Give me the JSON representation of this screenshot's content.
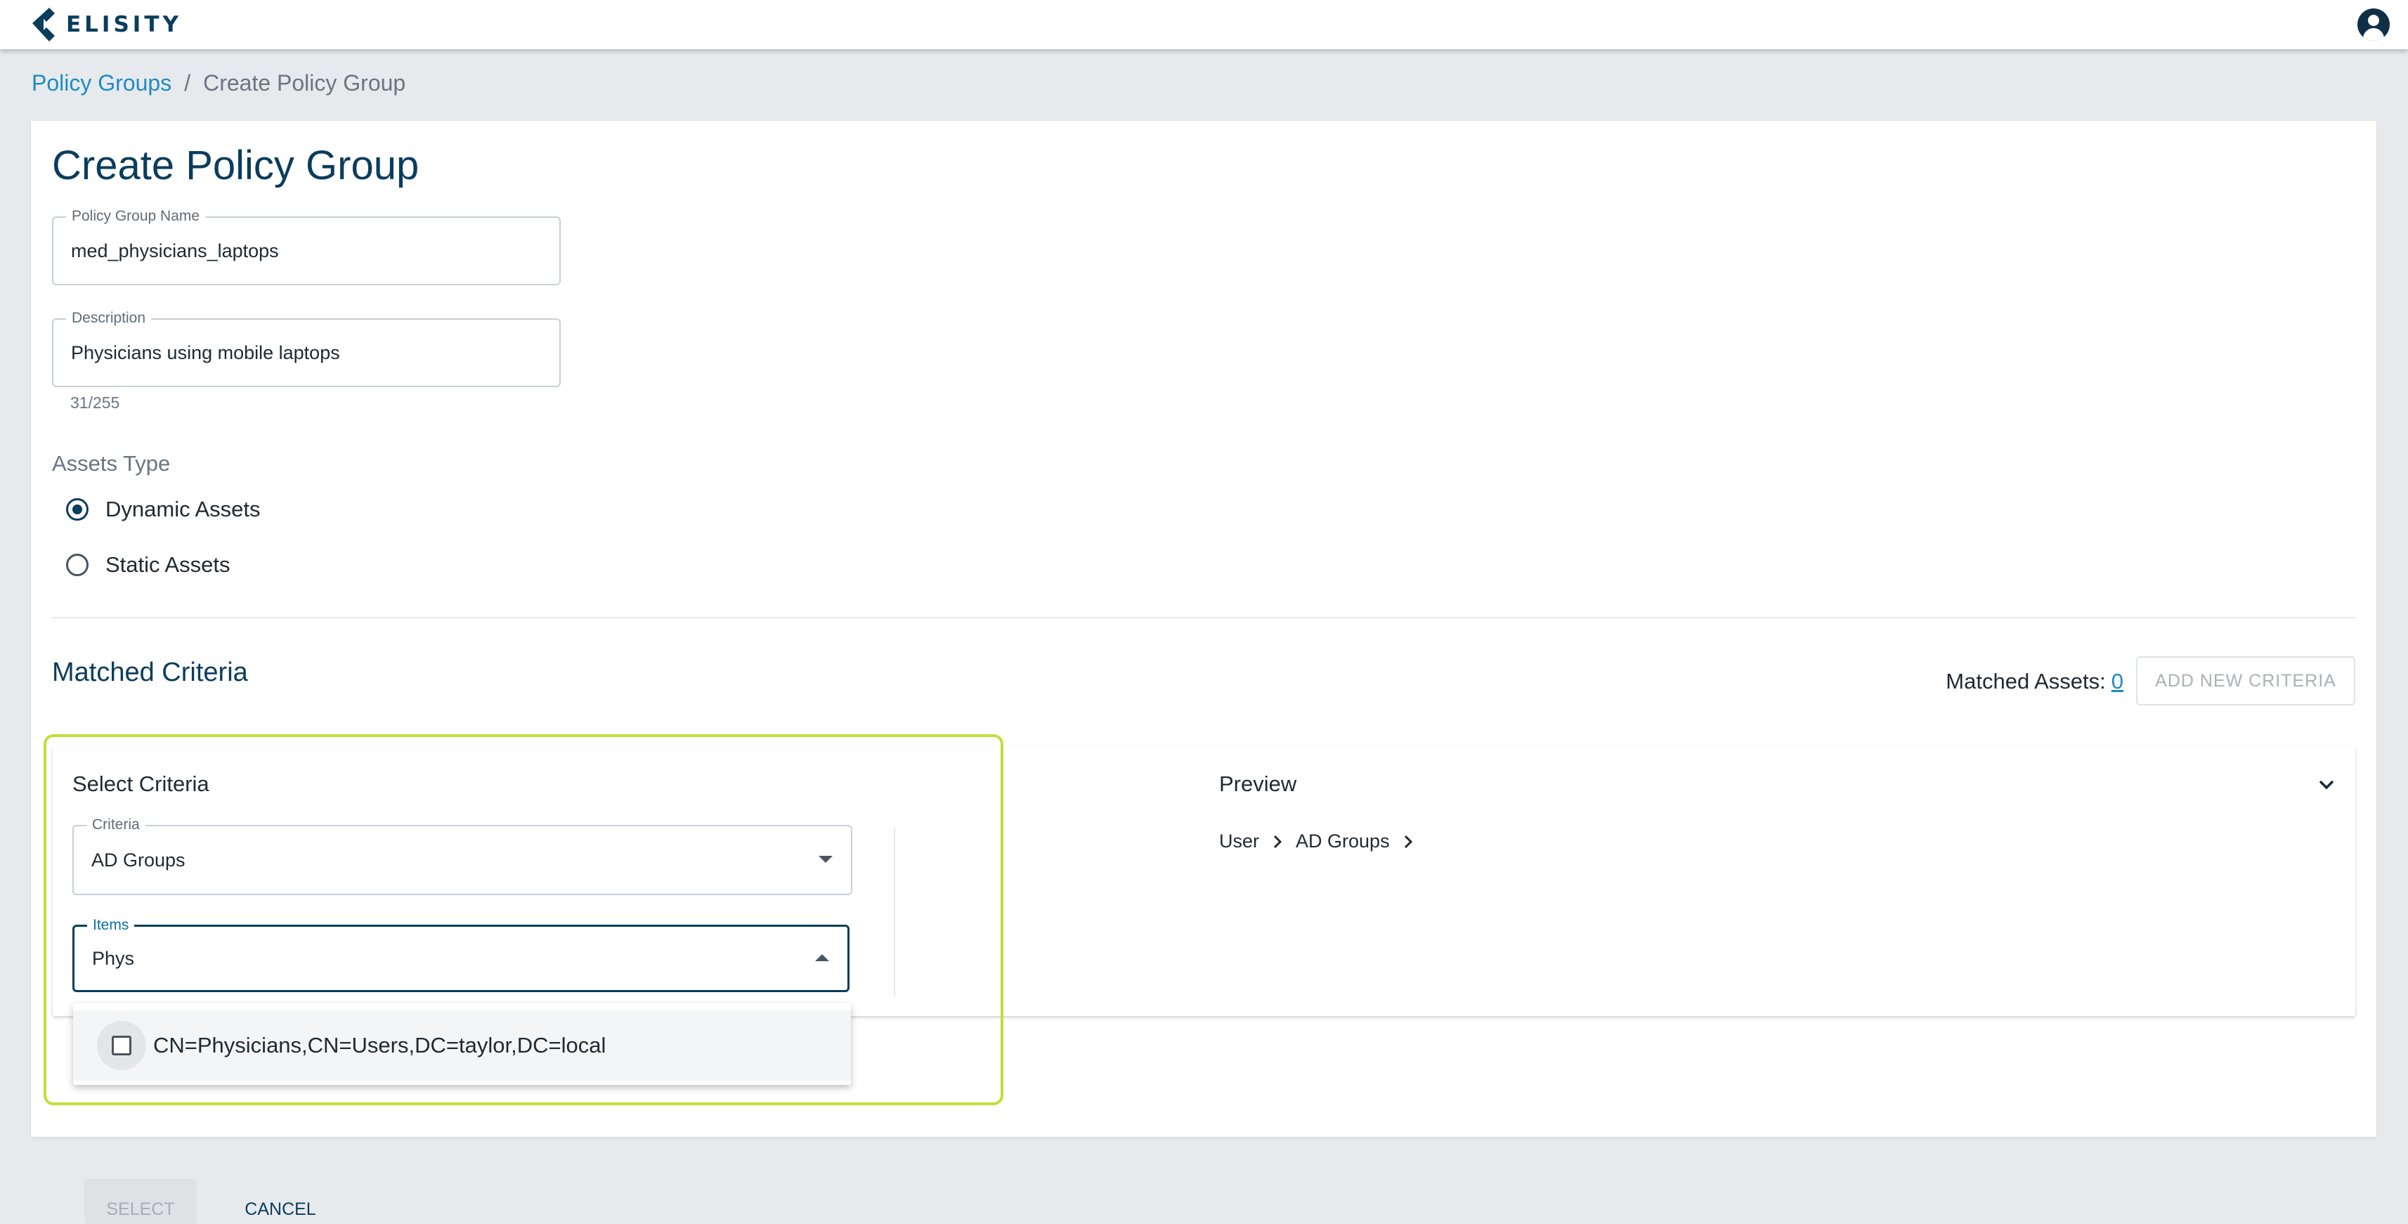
{
  "header": {
    "logo_text": "ELISITY",
    "avatar_icon": "user-avatar-icon",
    "colors": {
      "brand": "#0b3d5c",
      "link": "#1f8bc4",
      "highlight": "#c3dd3a"
    }
  },
  "breadcrumb": {
    "parent": "Policy Groups",
    "separator": "/",
    "current": "Create Policy Group"
  },
  "form": {
    "title": "Create Policy Group",
    "name_label": "Policy Group Name",
    "name_value": "med_physicians_laptops",
    "description_label": "Description",
    "description_value": "Physicians using mobile laptops",
    "description_counter": "31/255",
    "assets_type_label": "Assets Type",
    "assets_options": [
      {
        "label": "Dynamic Assets",
        "checked": true
      },
      {
        "label": "Static Assets",
        "checked": false
      }
    ]
  },
  "criteria": {
    "section_title": "Matched Criteria",
    "matched_assets_label": "Matched Assets:",
    "matched_assets_count": "0",
    "add_button": "ADD NEW CRITERIA",
    "select_title": "Select Criteria",
    "criteria_label": "Criteria",
    "criteria_value": "AD Groups",
    "items_label": "Items",
    "items_value": "Phys",
    "preview_title": "Preview",
    "preview_path": [
      "User",
      "AD Groups"
    ],
    "dropdown_options": [
      "CN=Physicians,CN=Users,DC=taylor,DC=local"
    ],
    "select_button": "SELECT",
    "cancel_button": "CANCEL"
  }
}
